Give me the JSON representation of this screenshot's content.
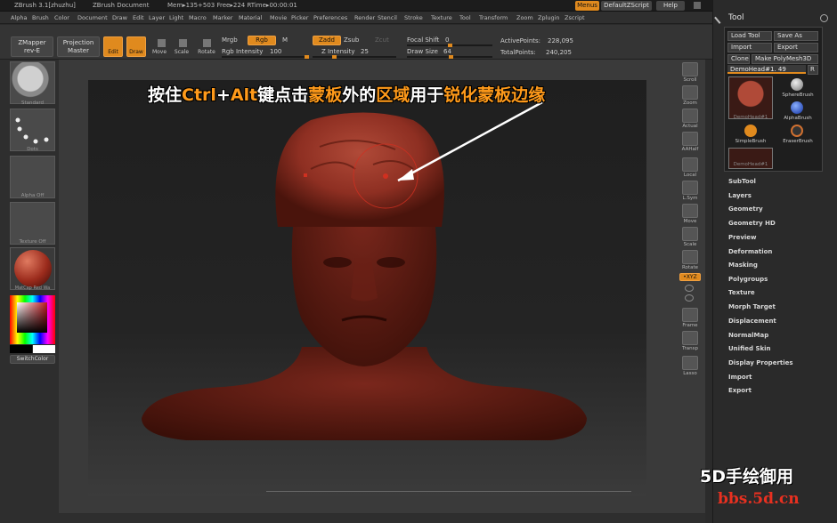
{
  "titlebar": {
    "app": "ZBrush  3.1[zhuzhu]",
    "doc": "ZBrush Document",
    "mem": "Mem▸135+503 Free▸224 RTime▸00:00:01",
    "menus_btn": "Menus",
    "script_btn": "DefaultZScript",
    "help_btn": "Help"
  },
  "menubar": [
    "Alpha",
    "Brush",
    "Color",
    "Document",
    "Draw",
    "Edit",
    "Layer",
    "Light",
    "Macro",
    "Marker",
    "Material",
    "Movie",
    "Picker",
    "Preferences",
    "Render",
    "Stencil",
    "Stroke",
    "Texture",
    "Tool",
    "Transform",
    "Zoom",
    "Zplugin",
    "Zscript"
  ],
  "toolbar": {
    "zmapper": "ZMapper",
    "zmapper_sub": "rev-E",
    "projection": "Projection",
    "projection_sub": "Master",
    "edit": "Edit",
    "draw": "Draw",
    "move": "Move",
    "scale": "Scale",
    "rotate": "Rotate",
    "mrgb": "Mrgb",
    "rgb": "Rgb",
    "m": "M",
    "rgb_intensity_label": "Rgb Intensity",
    "rgb_intensity_value": "100",
    "zadd": "Zadd",
    "zsub": "Zsub",
    "zcut": "Zcut",
    "z_intensity_label": "Z Intensity",
    "z_intensity_value": "25",
    "focal_shift_label": "Focal Shift",
    "focal_shift_value": "0",
    "draw_size_label": "Draw Size",
    "draw_size_value": "64",
    "active_points_label": "ActivePoints:",
    "active_points_value": "228,095",
    "total_points_label": "TotalPoints:",
    "total_points_value": "240,205"
  },
  "leftshelf": {
    "standard": "Standard",
    "dots": "Dots",
    "alpha": "Alpha  Off",
    "texture": "Texture  Off",
    "matcap": "MatCap  Red  Wa",
    "switchcolor": "SwitchColor"
  },
  "rightshelf": [
    "Scroll",
    "Zoom",
    "Actual",
    "AAHalf",
    "Local",
    "L.Sym",
    "Move",
    "Scale",
    "Rotate",
    "Frame",
    "Transp",
    "Lasso"
  ],
  "xyz_btn": "•XYZ",
  "overlay": {
    "p1": "按住",
    "ctrl": "Ctrl",
    "plus": "+",
    "alt": "Alt",
    "p2": "键点击",
    "mask": "蒙板",
    "p3": "外的",
    "area": "区域",
    "p4": "用于",
    "sharpen": "锐化蒙板边缘"
  },
  "tray": {
    "title": "Tool",
    "load_tool": "Load Tool",
    "save_as": "Save As",
    "import": "Import",
    "export": "Export",
    "clone": "Clone",
    "make_polymesh": "Make PolyMesh3D",
    "current_tool": "DemoHead#1. 49",
    "r": "R",
    "tools": [
      "DemoHead#1",
      "SphereBrush",
      "AlphaBrush",
      "SimpleBrush",
      "EraserBrush",
      "DemoHead#1"
    ],
    "sections": [
      "SubTool",
      "Layers",
      "Geometry",
      "Geometry HD",
      "Preview",
      "Deformation",
      "Masking",
      "Polygroups",
      "Texture",
      "Morph Target",
      "Displacement",
      "NormalMap",
      "Unified Skin",
      "Display Properties",
      "Import",
      "Export"
    ]
  },
  "watermark": {
    "line1": "5D手绘御用",
    "line2": "bbs.5d.cn"
  },
  "colors": {
    "accent": "#e08a1e",
    "overlay_highlight": "#ff9a1a",
    "model": "#8e2f22",
    "watermark_url": "#e83020"
  }
}
